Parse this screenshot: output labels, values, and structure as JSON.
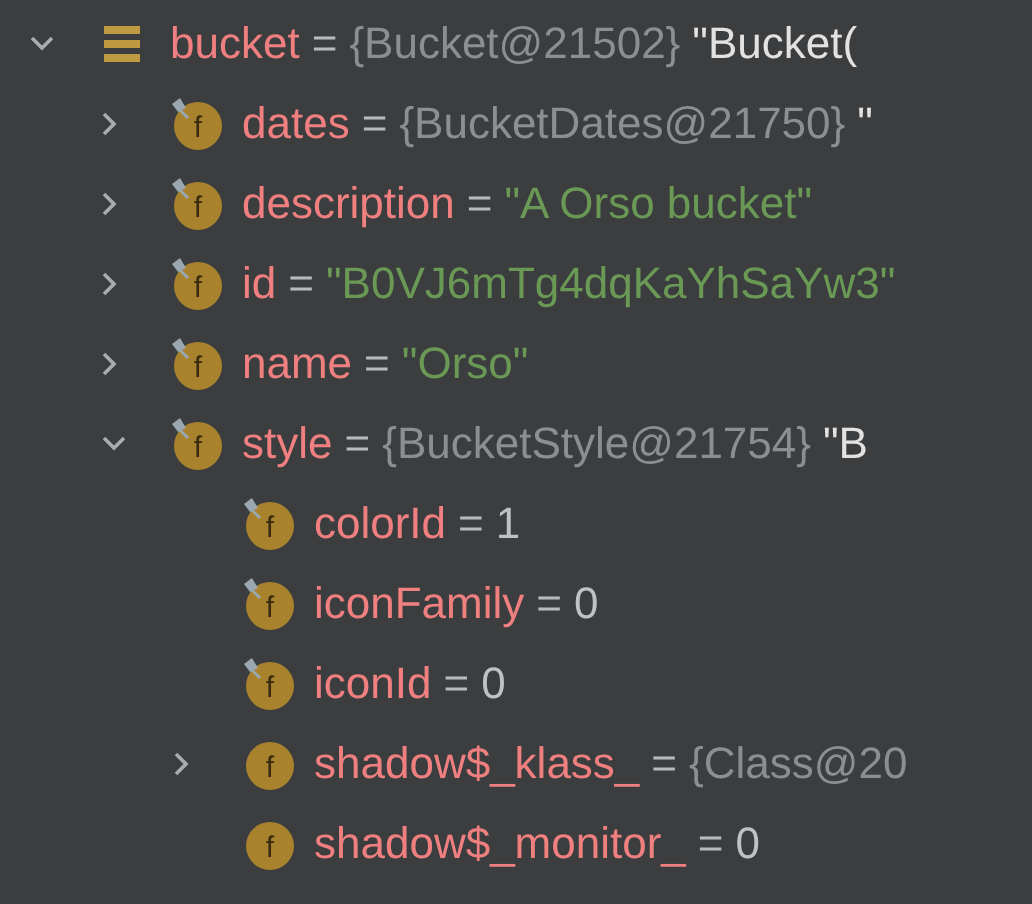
{
  "tree": [
    {
      "name": "bucket",
      "kind": "object",
      "expanded": true,
      "operator": "=",
      "type_ref": "{Bucket@21502}",
      "preview": "\"Bucket(",
      "children": [
        {
          "name": "dates",
          "kind": "field",
          "icon_letter": "f",
          "final": true,
          "expanded": false,
          "operator": "=",
          "type_ref": "{BucketDates@21750}",
          "preview": "\""
        },
        {
          "name": "description",
          "kind": "field",
          "icon_letter": "f",
          "final": true,
          "expanded": false,
          "operator": "=",
          "string_value": "\"A Orso bucket\""
        },
        {
          "name": "id",
          "kind": "field",
          "icon_letter": "f",
          "final": true,
          "expanded": false,
          "operator": "=",
          "string_value": "\"B0VJ6mTg4dqKaYhSaYw3\""
        },
        {
          "name": "name",
          "kind": "field",
          "icon_letter": "f",
          "final": true,
          "expanded": false,
          "operator": "=",
          "string_value": "\"Orso\""
        },
        {
          "name": "style",
          "kind": "field",
          "icon_letter": "f",
          "final": true,
          "expanded": true,
          "operator": "=",
          "type_ref": "{BucketStyle@21754}",
          "preview": "\"B",
          "children": [
            {
              "name": "colorId",
              "kind": "field",
              "icon_letter": "f",
              "final": true,
              "operator": "=",
              "number_value": "1"
            },
            {
              "name": "iconFamily",
              "kind": "field",
              "icon_letter": "f",
              "final": true,
              "operator": "=",
              "number_value": "0"
            },
            {
              "name": "iconId",
              "kind": "field",
              "icon_letter": "f",
              "final": true,
              "operator": "=",
              "number_value": "0"
            },
            {
              "name": "shadow$_klass_",
              "kind": "field",
              "icon_letter": "f",
              "final": false,
              "expanded": false,
              "operator": "=",
              "type_ref": "{Class@20"
            },
            {
              "name": "shadow$_monitor_",
              "kind": "field",
              "icon_letter": "f",
              "final": false,
              "operator": "=",
              "number_value": "0"
            }
          ]
        }
      ]
    }
  ]
}
